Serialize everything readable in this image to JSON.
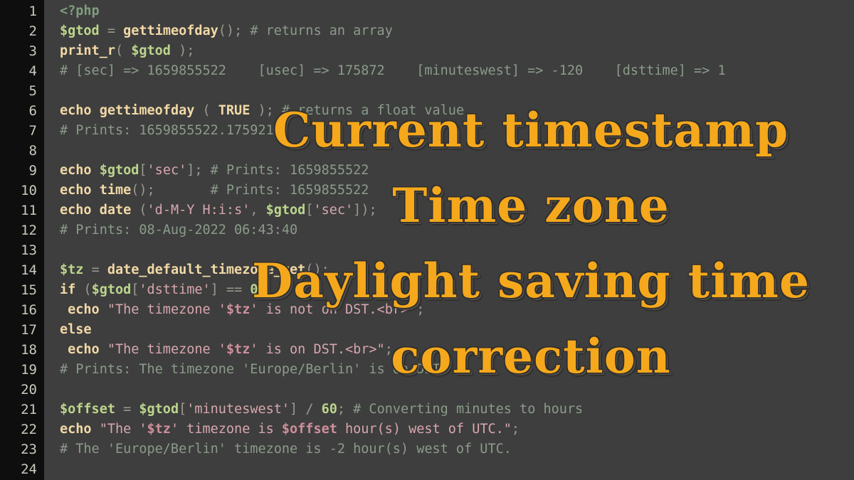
{
  "editor": {
    "language": "php",
    "background_color": "#3e3e3e",
    "gutter_color": "#0e0e0e",
    "line_numbers": [
      "1",
      "2",
      "3",
      "4",
      "5",
      "6",
      "7",
      "8",
      "9",
      "10",
      "11",
      "12",
      "13",
      "14",
      "15",
      "16",
      "17",
      "18",
      "19",
      "20",
      "21",
      "22",
      "23",
      "24"
    ],
    "lines": [
      "<?php",
      "$gtod = gettimeofday(); # returns an array",
      "print_r( $gtod );",
      "# [sec] => 1659855522    [usec] => 175872    [minuteswest] => -120    [dsttime] => 1",
      "",
      "echo gettimeofday ( TRUE ); # returns a float value",
      "# Prints: 1659855522.175921",
      "",
      "echo $gtod['sec']; # Prints: 1659855522",
      "echo time();       # Prints: 1659855522",
      "echo date ('d-M-Y H:i:s', $gtod['sec']);",
      "# Prints: 08-Aug-2022 06:43:40",
      "",
      "$tz = date_default_timezone_get();",
      "if ($gtod['dsttime'] == 0)",
      " echo \"The timezone '$tz' is not on DST.<br>\";",
      "else",
      " echo \"The timezone '$tz' is on DST.<br>\";",
      "# Prints: The timezone 'Europe/Berlin' is on DST.",
      "",
      "$offset = $gtod['minuteswest'] / 60; # Converting minutes to hours",
      "echo \"The '$tz' timezone is $offset hour(s) west of UTC.\";",
      "# The 'Europe/Berlin' timezone is -2 hour(s) west of UTC.",
      ""
    ]
  },
  "overlay": {
    "color": "#f5a81c",
    "lines": [
      "Current timestamp",
      "Time zone",
      "Daylight saving time",
      "correction"
    ]
  }
}
